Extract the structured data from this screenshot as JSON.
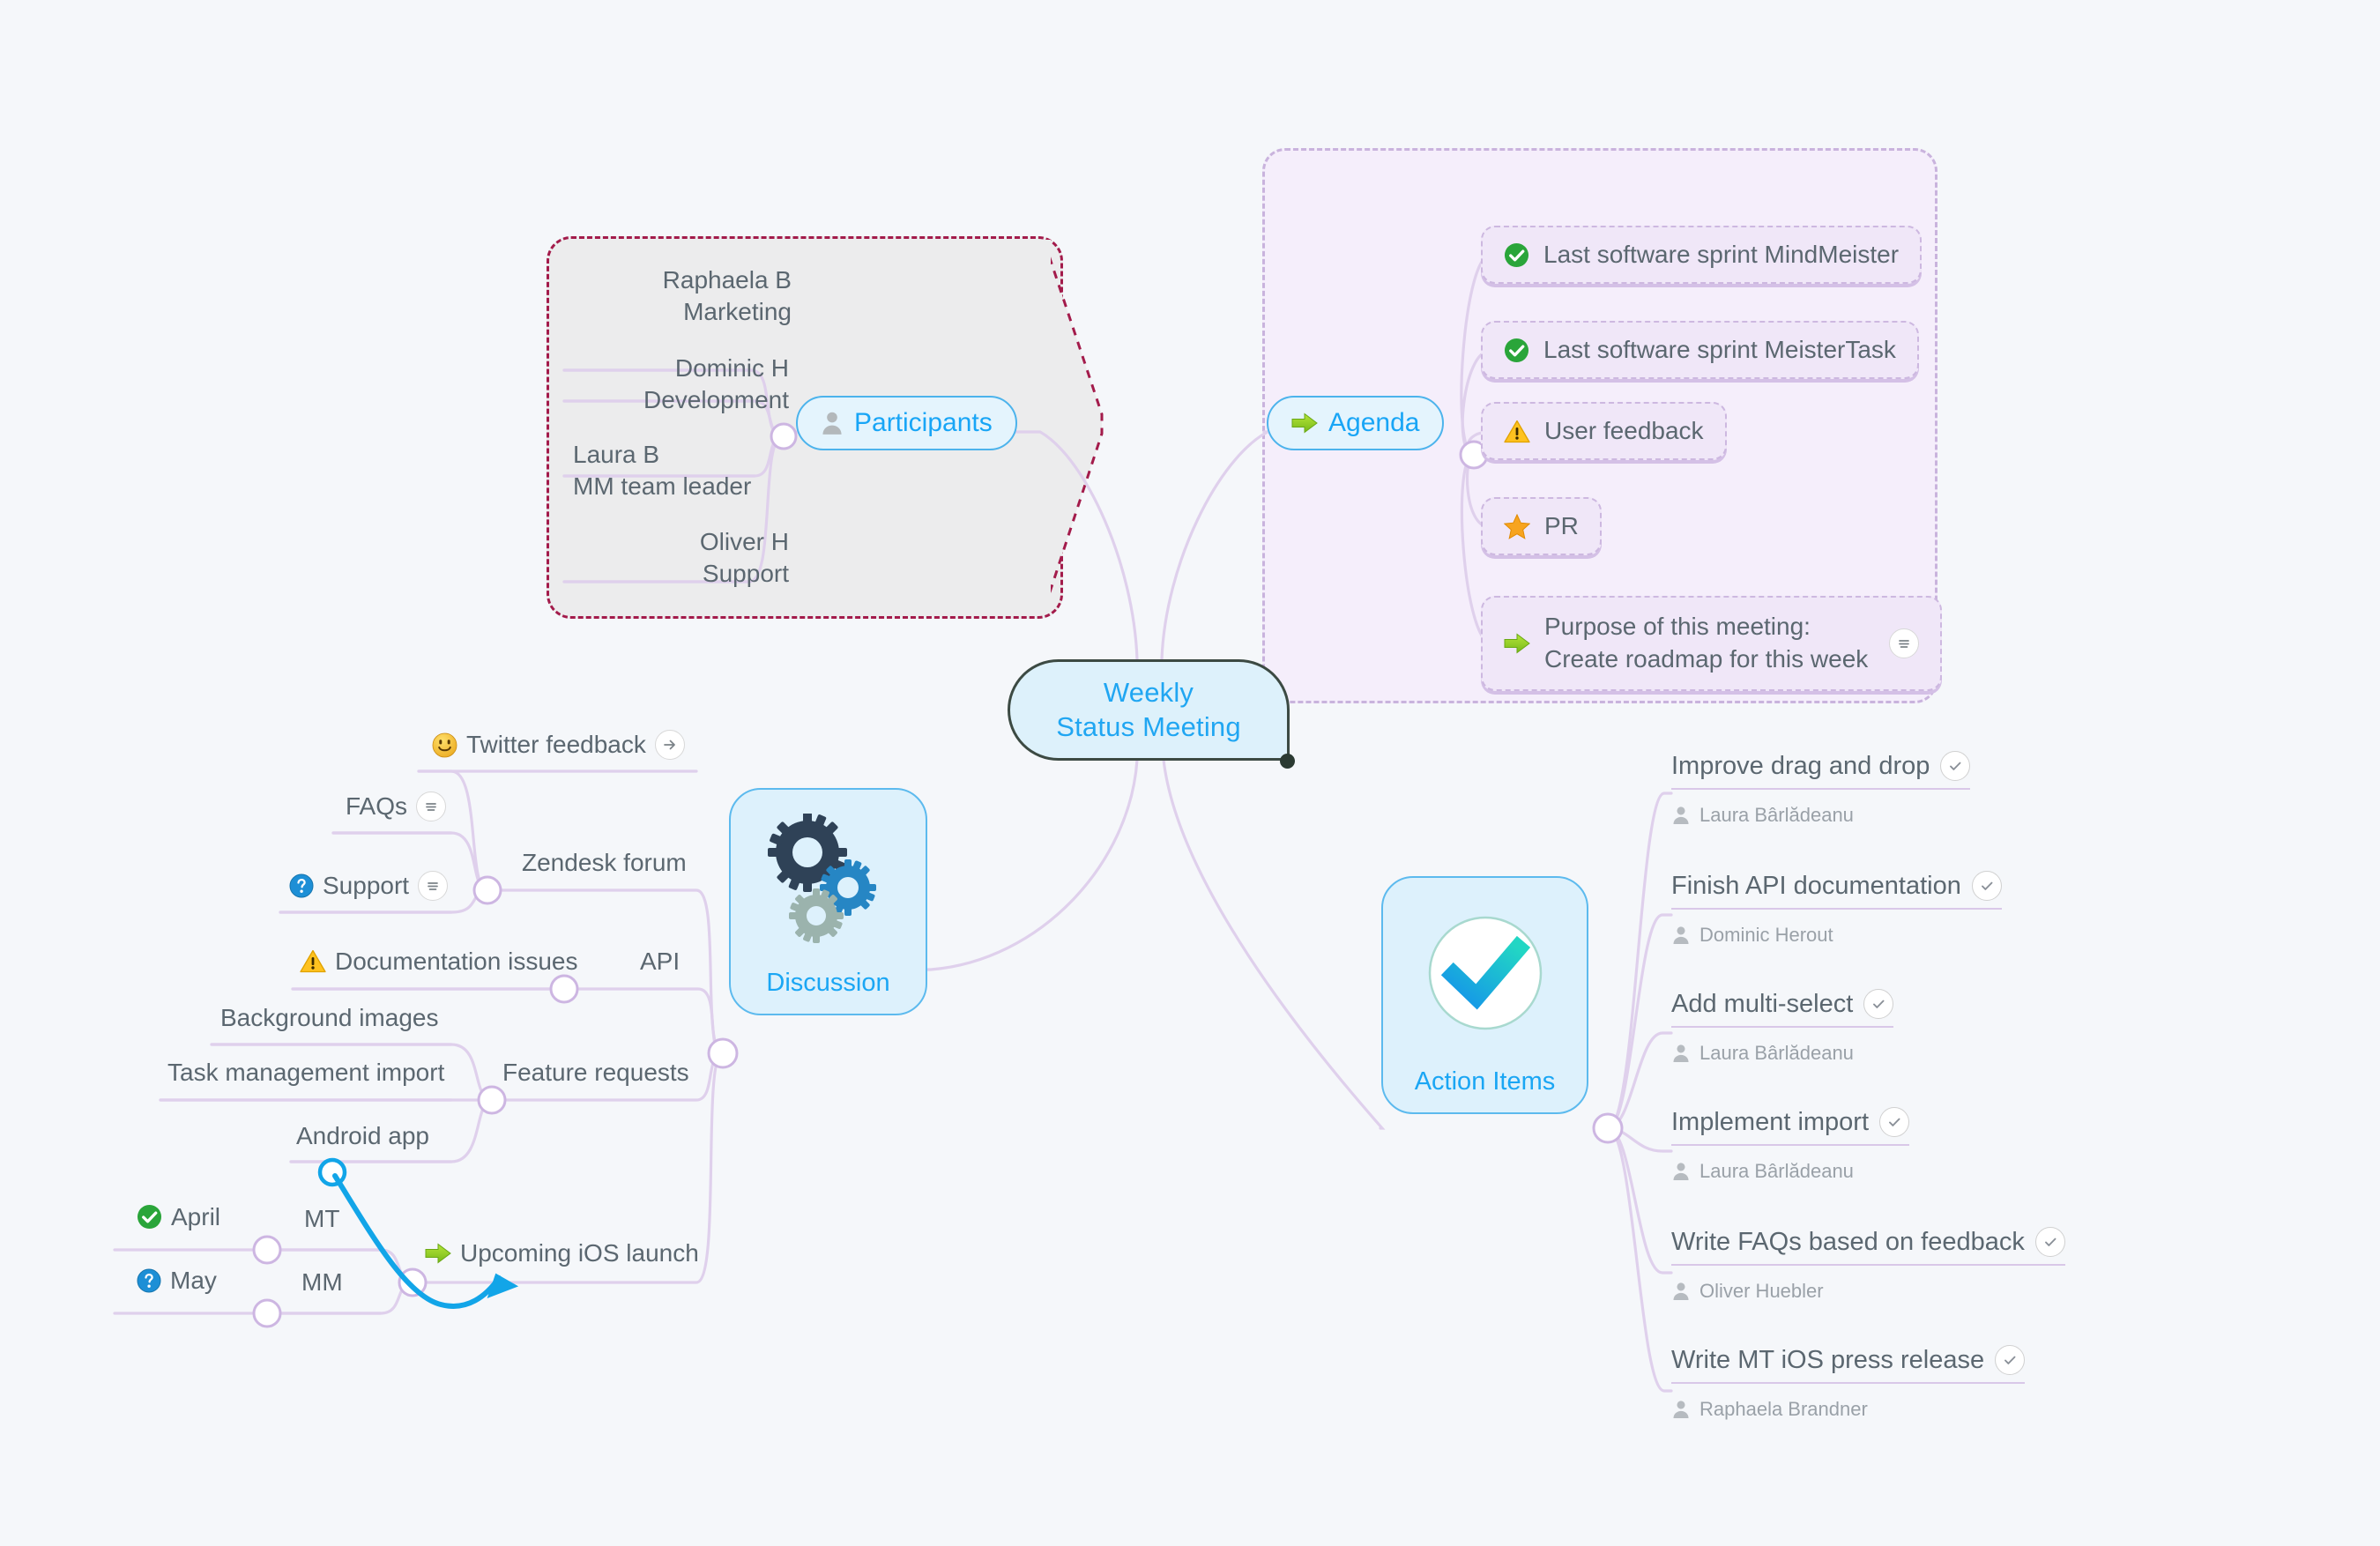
{
  "canvas": {
    "background_color": "#f5f7fa",
    "accent_blue": "#18a5f6",
    "connector_color": "#dfd0ec",
    "text_gray": "#5b6770",
    "assignee_gray": "#9aa1a8"
  },
  "root": {
    "line1": "Weekly",
    "line2": "Status Meeting"
  },
  "branches": {
    "participants": {
      "label": "Participants",
      "icon": "person-icon",
      "boundary_border_color": "#a31b4b",
      "boundary_fill_color": "#ececed",
      "members": [
        {
          "name": "Raphaela B",
          "role": "Marketing"
        },
        {
          "name": "Dominic H",
          "role": "Development"
        },
        {
          "name": "Laura B",
          "role": "MM team leader"
        },
        {
          "name": "Oliver H",
          "role": "Support"
        }
      ]
    },
    "agenda": {
      "label": "Agenda",
      "icon": "green-arrow-icon",
      "boundary_border_color": "#c9b3dd",
      "boundary_fill_color": "#f5eefb",
      "items": [
        {
          "text": "Last software sprint MindMeister",
          "icon": "green-check-icon",
          "note": false
        },
        {
          "text": "Last software sprint MeisterTask",
          "icon": "green-check-icon",
          "note": false
        },
        {
          "text": "User feedback",
          "icon": "warning-icon",
          "note": false
        },
        {
          "text": "PR",
          "icon": "star-icon",
          "note": false
        },
        {
          "text_line1": "Purpose of this meeting:",
          "text_line2": "Create roadmap for this week",
          "icon": "green-arrow-icon",
          "note": true
        }
      ]
    },
    "discussion": {
      "label": "Discussion",
      "icon": "gears-icon",
      "children": [
        {
          "label": "Zendesk forum",
          "children": [
            {
              "label": "Twitter feedback",
              "icon": "smiley-icon",
              "badge": "link-arrow-icon"
            },
            {
              "label": "FAQs",
              "badge": "note-icon"
            },
            {
              "label": "Support",
              "icon": "question-icon",
              "badge": "note-icon"
            }
          ]
        },
        {
          "label": "API",
          "children": [
            {
              "label": "Documentation issues",
              "icon": "warning-icon"
            }
          ]
        },
        {
          "label": "Feature requests",
          "children": [
            {
              "label": "Background images"
            },
            {
              "label": "Task management import"
            },
            {
              "label": "Android app"
            }
          ]
        },
        {
          "label": "Upcoming iOS launch",
          "icon": "green-arrow-icon",
          "children": [
            {
              "label": "MT",
              "children": [
                {
                  "label": "April",
                  "icon": "green-check-icon"
                }
              ]
            },
            {
              "label": "MM",
              "children": [
                {
                  "label": "May",
                  "icon": "question-icon"
                }
              ]
            }
          ]
        }
      ]
    },
    "action_items": {
      "label": "Action Items",
      "icon": "blue-checkmark-icon",
      "items": [
        {
          "task": "Improve drag and drop",
          "assignee": "Laura Bârlădeanu",
          "badge": "checkbox-icon"
        },
        {
          "task": "Finish API documentation",
          "assignee": "Dominic Herout",
          "badge": "checkbox-icon"
        },
        {
          "task": "Add multi-select",
          "assignee": "Laura Bârlădeanu",
          "badge": "checkbox-icon"
        },
        {
          "task": "Implement import",
          "assignee": "Laura Bârlădeanu",
          "badge": "checkbox-icon"
        },
        {
          "task": "Write FAQs based on feedback",
          "assignee": "Oliver Huebler",
          "badge": "checkbox-icon"
        },
        {
          "task": "Write MT iOS press release",
          "assignee": "Raphaela Brandner",
          "badge": "checkbox-icon"
        }
      ]
    }
  }
}
